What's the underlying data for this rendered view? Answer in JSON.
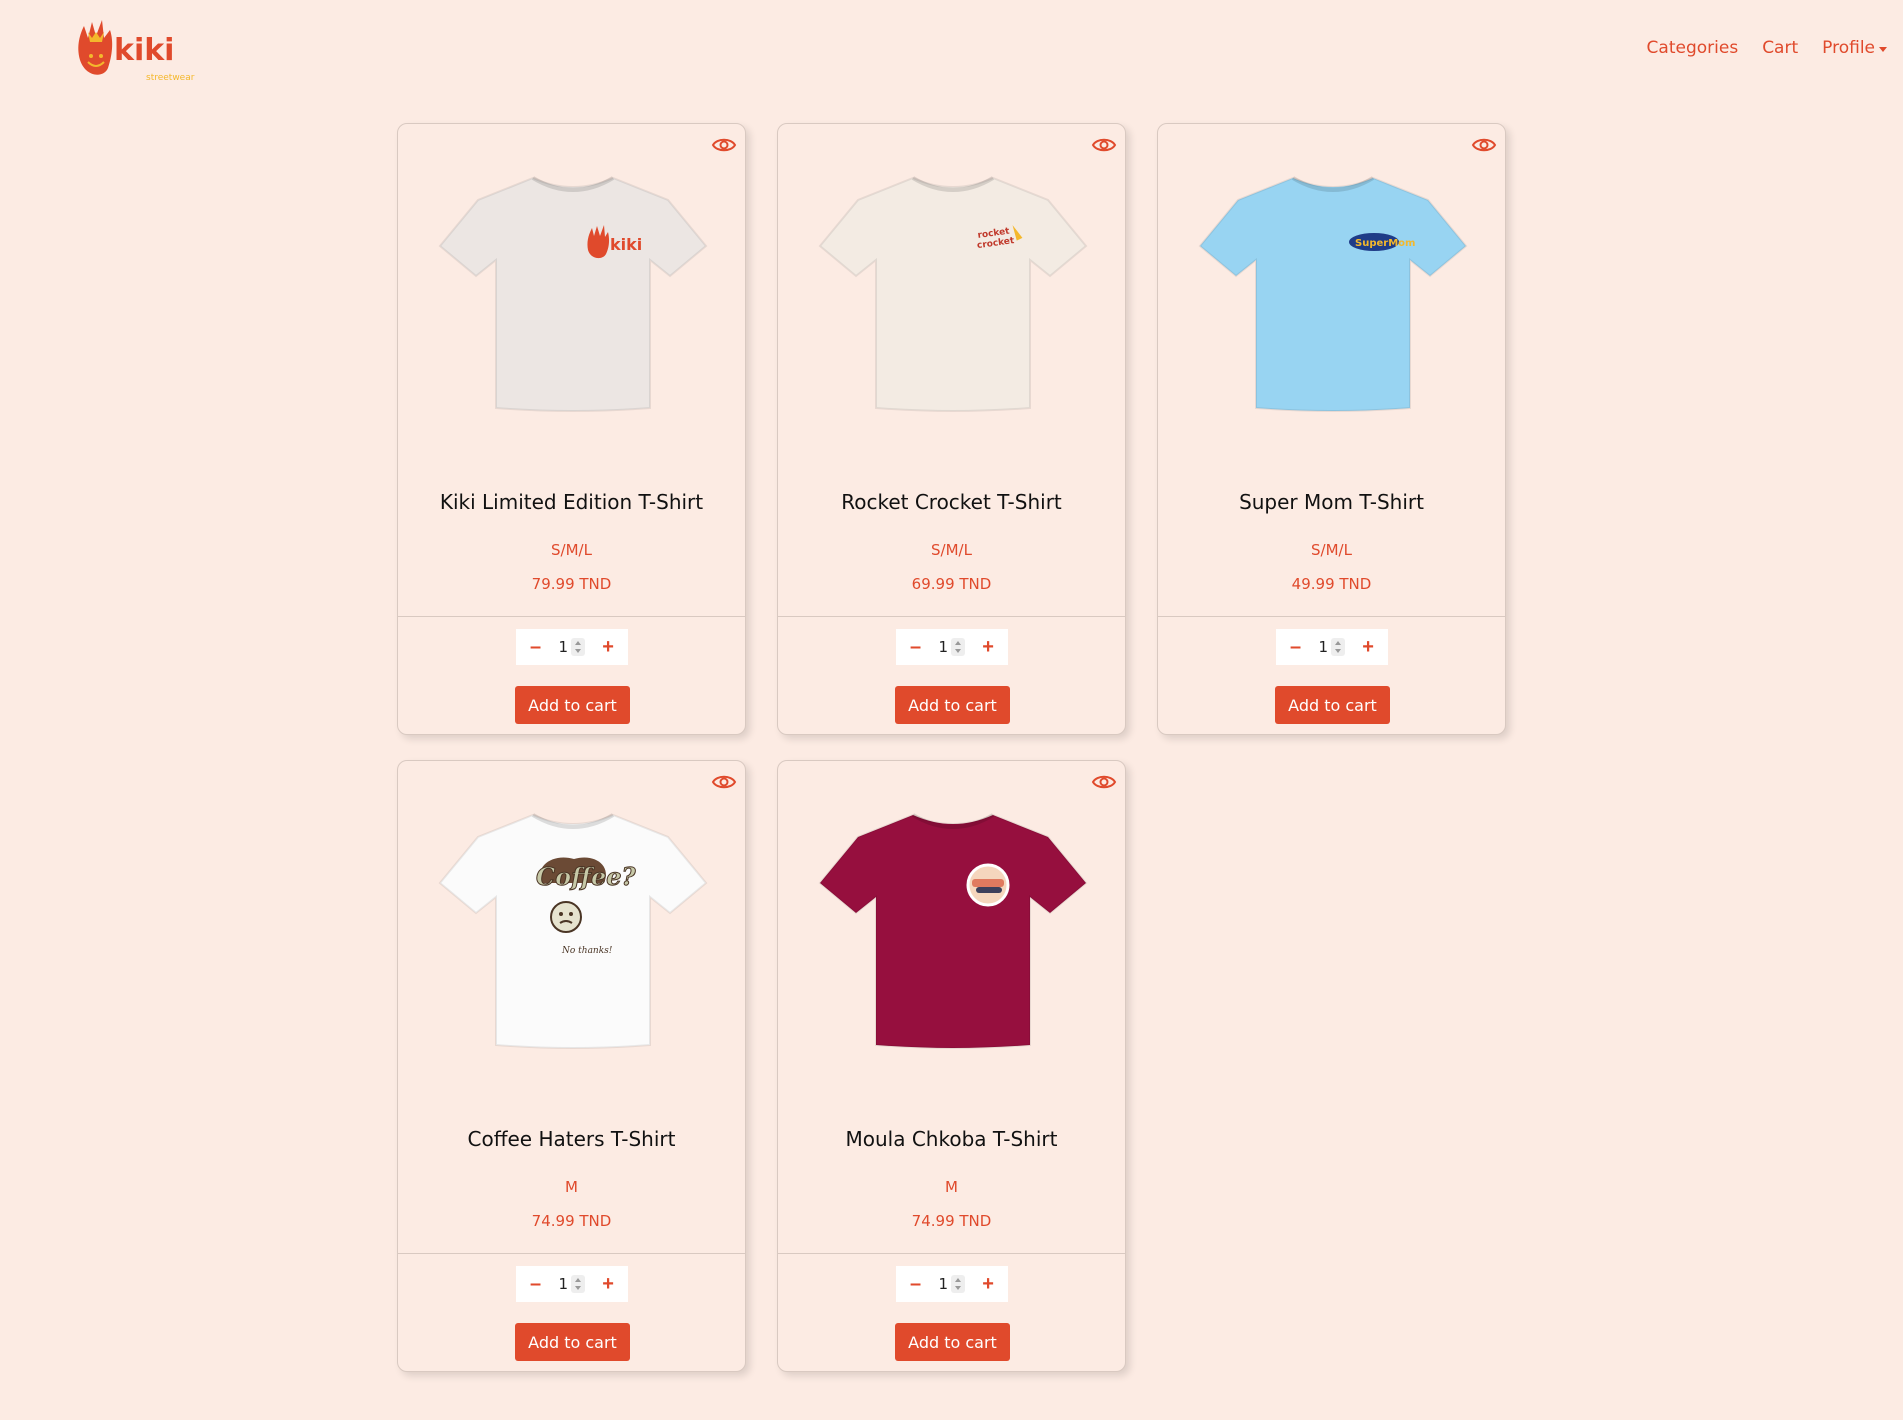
{
  "brand": {
    "name": "kiki",
    "tagline": "streetwear",
    "accent": "#e04a2c",
    "yellow": "#f4b82c"
  },
  "nav": {
    "categories": "Categories",
    "cart": "Cart",
    "profile": "Profile"
  },
  "products": [
    {
      "name": "Kiki Limited Edition T-Shirt",
      "sizes": "S/M/L",
      "price": "79.99 TND",
      "qty": "1",
      "add_label": "Add to cart",
      "shirt_color": "#ece6e3",
      "print": "kiki"
    },
    {
      "name": "Rocket Crocket T-Shirt",
      "sizes": "S/M/L",
      "price": "69.99 TND",
      "qty": "1",
      "add_label": "Add to cart",
      "shirt_color": "#f3ebe3",
      "print": "rocket"
    },
    {
      "name": "Super Mom T-Shirt",
      "sizes": "S/M/L",
      "price": "49.99 TND",
      "qty": "1",
      "add_label": "Add to cart",
      "shirt_color": "#98d4f2",
      "print": "supermom"
    },
    {
      "name": "Coffee Haters T-Shirt",
      "sizes": "M",
      "price": "74.99 TND",
      "qty": "1",
      "add_label": "Add to cart",
      "shirt_color": "#fbfbfb",
      "print": "coffee"
    },
    {
      "name": "Moula Chkoba T-Shirt",
      "sizes": "M",
      "price": "74.99 TND",
      "qty": "1",
      "add_label": "Add to cart",
      "shirt_color": "#960f3e",
      "print": "moula"
    }
  ]
}
